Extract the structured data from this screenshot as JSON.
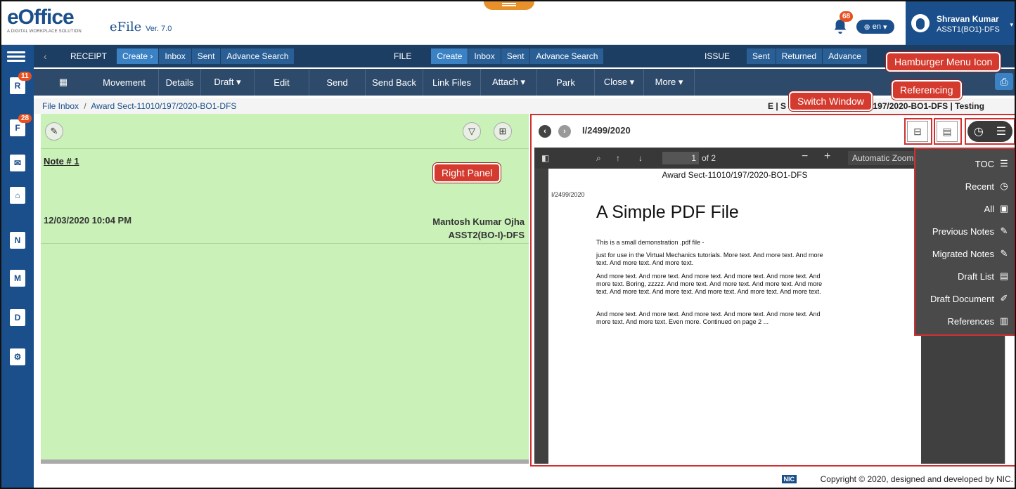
{
  "app": {
    "brand": "eOffice",
    "tagline": "A DIGITAL WORKPLACE SOLUTION",
    "product": "eFile",
    "version": "Ver. 7.0"
  },
  "header": {
    "notification_count": "68",
    "language": "en",
    "user_name": "Shravan Kumar",
    "user_role": "ASST1(BO1)-DFS"
  },
  "sidebar": {
    "badges": {
      "receipts": "11",
      "files": "28"
    },
    "icons": [
      "hamburger-icon",
      "receipt-icon",
      "file-icon",
      "dak-icon",
      "inbox-icon",
      "mail-icon",
      "file-transfer-icon",
      "doc-icon",
      "settings-user-icon"
    ]
  },
  "menubar": {
    "receipt": {
      "label": "RECEIPT",
      "items": [
        "Create ›",
        "Inbox",
        "Sent",
        "Advance Search"
      ]
    },
    "file": {
      "label": "FILE",
      "items": [
        "Create",
        "Inbox",
        "Sent",
        "Advance Search"
      ]
    },
    "issue": {
      "label": "ISSUE",
      "items": [
        "Sent",
        "Returned",
        "Advance"
      ]
    }
  },
  "toolbar": {
    "items": [
      "Movement",
      "Details",
      "Draft ▾",
      "Edit",
      "Send",
      "Send Back",
      "Link Files",
      "Attach ▾",
      "Park",
      "Close ▾",
      "More ▾"
    ]
  },
  "breadcrumb": {
    "root": "File Inbox",
    "sep": "/",
    "current": "Award Sect-11010/197/2020-BO1-DFS",
    "right_text": "E  |  S",
    "right_text2": "0/197/2020-BO1-DFS  |  Testing"
  },
  "left_panel": {
    "note_title": "Note # 1",
    "date": "12/03/2020 10:04 PM",
    "author_name": "Mantosh Kumar Ojha",
    "author_role": "ASST2(BO-I)-DFS"
  },
  "right_panel": {
    "doc_id": "I/2499/2020",
    "viewer": {
      "page_current": "1",
      "page_total": "of 2",
      "zoom": "Automatic Zoom"
    },
    "pdf": {
      "header": "Award Sect-11010/197/2020-BO1-DFS",
      "ref": "I/2499/2020",
      "title": "A Simple PDF File",
      "p1": "This is a small demonstration .pdf file -",
      "p2": "just for use in the Virtual Mechanics tutorials. More text. And more text. And more text. And more text. And more text.",
      "p3": "And more text. And more text. And more text. And more text. And more text. And more text. Boring, zzzzz. And more text. And more text. And more text. And more text. And more text. And more text. And more text. And more text. And more text.",
      "p4": "And more text. And more text. And more text. And more text. And more text. And more text. And more text. Even more. Continued on page 2 ..."
    }
  },
  "dropdown": {
    "items": [
      {
        "label": "TOC",
        "icon": "list-icon"
      },
      {
        "label": "Recent",
        "icon": "clock-icon"
      },
      {
        "label": "All",
        "icon": "pdf-icon"
      },
      {
        "label": "Previous Notes",
        "icon": "edit-note-icon"
      },
      {
        "label": "Migrated Notes",
        "icon": "edit-note-icon"
      },
      {
        "label": "Draft List",
        "icon": "draft-list-icon"
      },
      {
        "label": "Draft Document",
        "icon": "draft-doc-icon"
      },
      {
        "label": "References",
        "icon": "references-icon"
      }
    ]
  },
  "callouts": {
    "right_panel": "Right Panel",
    "switch_window": "Switch Window",
    "referencing": "Referencing",
    "hamburger": "Hamburger Menu Icon"
  },
  "footer": {
    "nic": "NIC",
    "copyright": "Copyright © 2020, designed and developed by NIC."
  },
  "colors": {
    "primary": "#1a4f8b",
    "menubar": "#1d3e63",
    "toolbar": "#2e4a6a",
    "note_bg": "#c9f1b8",
    "highlight": "#d03030",
    "badge": "#e8501f"
  }
}
